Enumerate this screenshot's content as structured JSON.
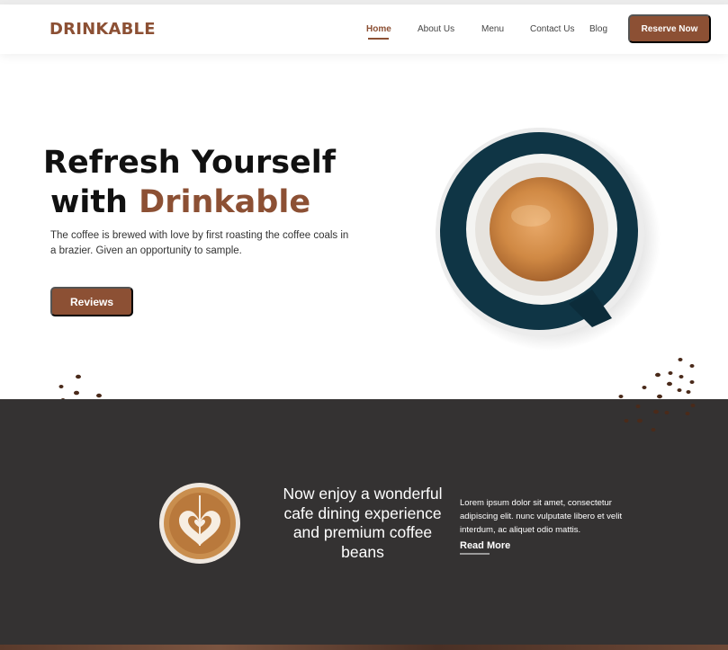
{
  "brand": {
    "logo_text": "DRINKABLE",
    "accent_color": "#8c5034"
  },
  "nav": {
    "items": [
      {
        "label": "Home",
        "active": true
      },
      {
        "label": "About Us",
        "active": false
      },
      {
        "label": "Menu",
        "active": false
      },
      {
        "label": "Contact Us",
        "active": false
      },
      {
        "label": "Blog",
        "active": false
      }
    ],
    "cta_label": "Reserve Now"
  },
  "hero": {
    "title_line1": "Refresh Yourself",
    "title_line2_prefix": "with",
    "title_line2_accent": "Drinkable",
    "description": "The coffee is brewed with love by first roasting the coffee coals in a brazier. Given an opportunity to sample.",
    "button_label": "Reviews",
    "image": "espresso-cup-top-view"
  },
  "feature": {
    "image": "latte-art-cup",
    "headline": "Now enjoy a wonderful cafe dining experience and premium coffee beans",
    "body": "Lorem ipsum dolor sit amet, consectetur adipiscing elit. nunc vulputate libero et velit interdum, ac aliquet odio mattis.",
    "link_label": "Read More",
    "background_color": "#343232"
  }
}
